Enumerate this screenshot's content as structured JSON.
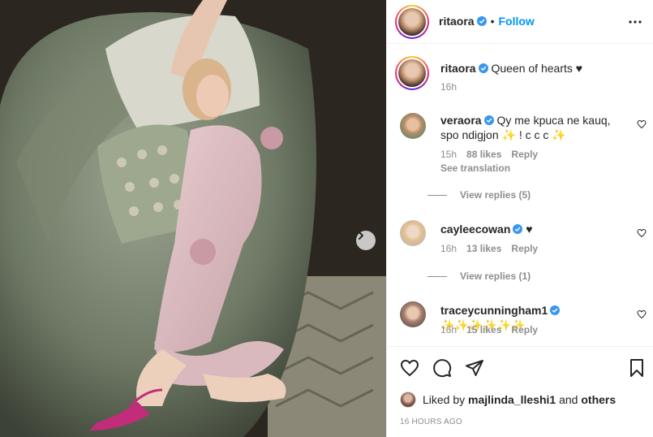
{
  "header": {
    "username": "ritaora",
    "separator": "•",
    "follow_label": "Follow"
  },
  "caption": {
    "username": "ritaora",
    "text": "Queen of hearts ♥",
    "time": "16h"
  },
  "comments": [
    {
      "username": "veraora",
      "text": "Qy me kpuca ne kauq, spo ndigjon ✨ ! c c c ✨",
      "time": "15h",
      "likes": "88 likes",
      "reply": "Reply",
      "see_translation": "See translation",
      "view_replies": "View replies (5)"
    },
    {
      "username": "cayleecowan",
      "text": "♥",
      "time": "16h",
      "likes": "13 likes",
      "reply": "Reply",
      "view_replies": "View replies (1)"
    },
    {
      "username": "traceycunningham1",
      "text": "✨✨✨✨✨✨",
      "time": "16h",
      "likes": "15 likes",
      "reply": "Reply"
    }
  ],
  "likes_line": {
    "prefix": "Liked by",
    "user": "majlinda_lleshi1",
    "and": "and",
    "others": "others"
  },
  "timestamp": "16 HOURS AGO",
  "icons": {
    "verified": "verified-badge-icon",
    "more": "more-options-icon",
    "like": "heart-icon",
    "comment": "comment-icon",
    "share": "paper-plane-icon",
    "save": "bookmark-icon",
    "next": "chevron-right-icon"
  },
  "colors": {
    "link": "#0095f6",
    "verified": "#3897f0",
    "muted": "#8e8e8e",
    "text": "#262626"
  }
}
